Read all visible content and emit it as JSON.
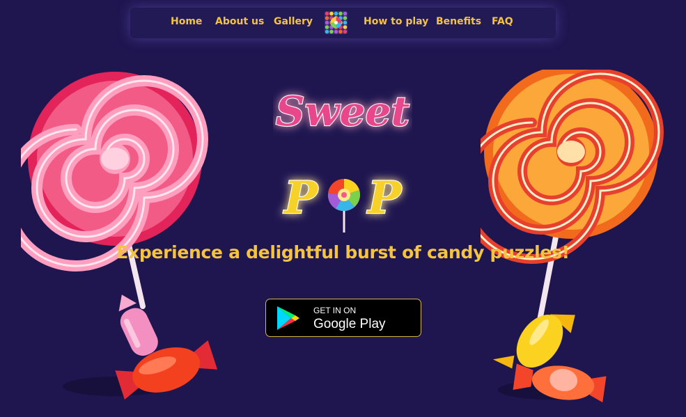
{
  "nav": {
    "items": [
      {
        "label": "Home"
      },
      {
        "label": "About us"
      },
      {
        "label": "Gallery"
      },
      {
        "label": "How to play"
      },
      {
        "label": "Benefits"
      },
      {
        "label": "FAQ"
      }
    ],
    "logo_icon": "candy-grid-logo-icon"
  },
  "hero": {
    "title_line1": "Sweet",
    "title_line2_left": "P",
    "title_line2_right": "P",
    "title_o_icon": "lollipop-icon",
    "tagline": "Experience a delightful burst of candy puzzles!"
  },
  "store_button": {
    "small": "GET IN ON",
    "big": "Google Play",
    "icon": "google-play-icon"
  },
  "colors": {
    "background": "#1f1650",
    "accent": "#f4c441",
    "title_pink": "#e8468c",
    "title_yellow": "#f6d12c"
  }
}
